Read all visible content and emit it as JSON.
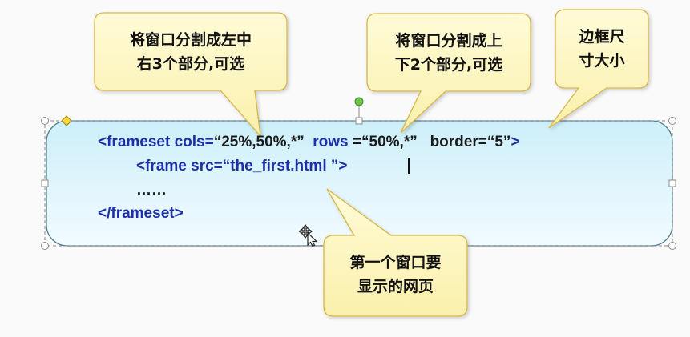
{
  "code_box": {
    "line1_tag": "<frameset cols=",
    "line1_cols_value": "“25%,50%,*”",
    "line1_rows_label": "rows",
    "line1_rows_eq": "=",
    "line1_rows_value": "“50%,*”",
    "line1_border_label": "border=",
    "line1_border_value": "“5”",
    "line1_close": ">",
    "line2_tag": "<frame src=",
    "line2_value": "“the_first.html ”",
    "line2_close": ">",
    "line3_ellipsis": "……",
    "line4_close_tag": "</frameset>"
  },
  "callouts": {
    "cols_line1": "将窗口分割成左中",
    "cols_line2": "右3个部分,可选",
    "rows_line1": "将窗口分割成上",
    "rows_line2": "下2个部分,可选",
    "border_line1": "边框尺",
    "border_line2": "寸大小",
    "frame_line1": "第一个窗口要",
    "frame_line2": "显示的网页"
  },
  "colors": {
    "tag_blue": "#1c2fa8",
    "value_dark": "#1a1a1a",
    "callout_fill": "#fdf6c0",
    "callout_border": "#d7b64a",
    "box_fill_top": "#cdeffa",
    "box_fill_bottom": "#f2fbff",
    "box_border": "#4e7f8a"
  },
  "icons": [
    "move-cursor-icon",
    "rotation-handle-icon",
    "adjust-handle-icon",
    "resize-handle-icon"
  ]
}
